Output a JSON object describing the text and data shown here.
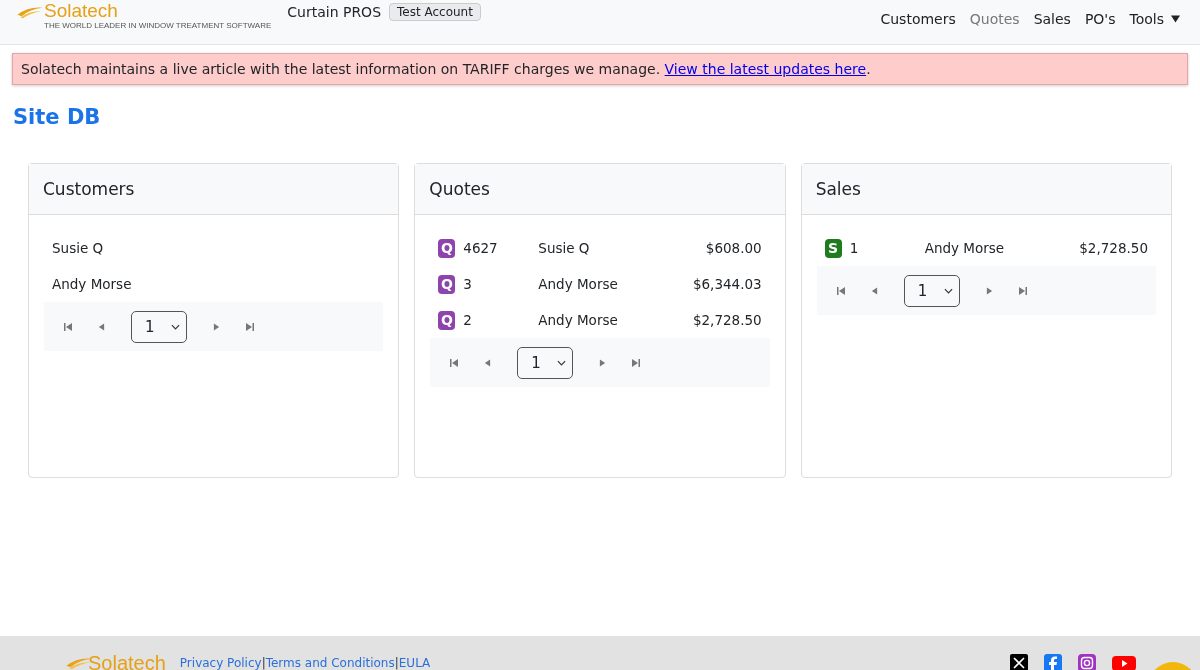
{
  "navbar": {
    "logo": "Solatech",
    "tagline": "THE WORLD LEADER IN WINDOW TREATMENT SOFTWARE",
    "app_name": "Curtain PROS",
    "account_badge": "Test Account",
    "items": [
      {
        "label": "Customers",
        "selected": false,
        "dropdown": false
      },
      {
        "label": "Quotes",
        "selected": true,
        "dropdown": false
      },
      {
        "label": "Sales",
        "selected": false,
        "dropdown": false
      },
      {
        "label": "PO's",
        "selected": false,
        "dropdown": false
      },
      {
        "label": "Tools",
        "selected": false,
        "dropdown": true
      }
    ]
  },
  "alert": {
    "text": "Solatech maintains a live article with the latest information on TARIFF charges we manage. ",
    "link": "View the latest updates here",
    "end": "."
  },
  "page_title": "Site DB",
  "cards": [
    {
      "title": "Customers",
      "kind": "names",
      "rows": [
        {
          "name": "Susie Q"
        },
        {
          "name": "Andy Morse"
        }
      ],
      "pager": {
        "page": "1"
      }
    },
    {
      "title": "Quotes",
      "kind": "records",
      "rows": [
        {
          "badge": "Q",
          "color": "#8e44ad",
          "number": "4627",
          "name": "Susie Q",
          "amount": "$608.00"
        },
        {
          "badge": "Q",
          "color": "#8e44ad",
          "number": "3",
          "name": "Andy Morse",
          "amount": "$6,344.03"
        },
        {
          "badge": "Q",
          "color": "#8e44ad",
          "number": "2",
          "name": "Andy Morse",
          "amount": "$2,728.50"
        }
      ],
      "pager": {
        "page": "1"
      }
    },
    {
      "title": "Sales",
      "kind": "records",
      "rows": [
        {
          "badge": "S",
          "color": "#1e7b1e",
          "number": "1",
          "name": "Andy Morse",
          "amount": "$2,728.50"
        }
      ],
      "pager": {
        "page": "1"
      }
    }
  ],
  "footer": {
    "logo": "Solatech",
    "links": [
      "Privacy Policy",
      "Terms and Conditions",
      "EULA"
    ],
    "separator": "|"
  }
}
